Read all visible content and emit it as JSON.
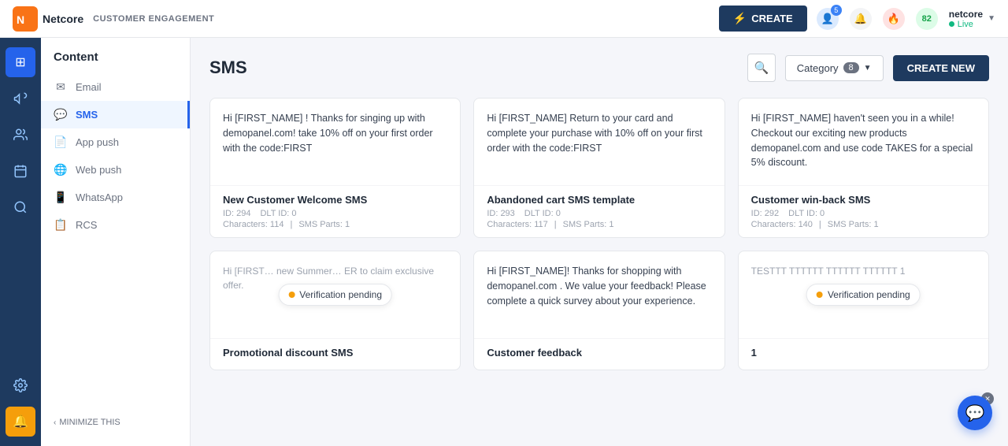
{
  "topnav": {
    "logo_text": "Netcore",
    "section_label": "CUSTOMER ENGAGEMENT",
    "create_button": "CREATE",
    "user_name": "netcore",
    "status": "Live",
    "notification_count": "5",
    "points": "82"
  },
  "sidebar": {
    "title": "Content",
    "items": [
      {
        "id": "email",
        "label": "Email",
        "icon": "✉"
      },
      {
        "id": "sms",
        "label": "SMS",
        "icon": "💬"
      },
      {
        "id": "app-push",
        "label": "App push",
        "icon": "📄"
      },
      {
        "id": "web-push",
        "label": "Web push",
        "icon": "🌐"
      },
      {
        "id": "whatsapp",
        "label": "WhatsApp",
        "icon": "📱"
      },
      {
        "id": "rcs",
        "label": "RCS",
        "icon": "📋"
      }
    ],
    "minimize_label": "MINIMIZE THIS"
  },
  "page": {
    "title": "SMS",
    "category_label": "Category",
    "category_count": "8",
    "create_new_label": "CREATE NEW"
  },
  "cards": [
    {
      "id": 1,
      "preview": "Hi [FIRST_NAME] ! Thanks for singing up with demopanel.com! take 10% off on your first order with the code:FIRST",
      "name": "New Customer Welcome SMS",
      "id_label": "ID: 294",
      "dlt_label": "DLT ID: 0",
      "chars": "Characters: 114",
      "sms_parts": "SMS Parts: 1",
      "verification": false
    },
    {
      "id": 2,
      "preview": "Hi [FIRST_NAME] Return to your card and complete your purchase with 10% off on your first order with the code:FIRST",
      "name": "Abandoned cart SMS template",
      "id_label": "ID: 293",
      "dlt_label": "DLT ID: 0",
      "chars": "Characters: 117",
      "sms_parts": "SMS Parts: 1",
      "verification": false
    },
    {
      "id": 3,
      "preview": "Hi [FIRST_NAME] haven't seen you in a while! Checkout our exciting new products demopanel.com and use code TAKES for a special 5% discount.",
      "name": "Customer win-back SMS",
      "id_label": "ID: 292",
      "dlt_label": "DLT ID: 0",
      "chars": "Characters: 140",
      "sms_parts": "SMS Parts: 1",
      "verification": false
    },
    {
      "id": 4,
      "preview": "Hi [FIRST... new Summer... ER to claim exclusive offer.",
      "name": "Promotional discount SMS",
      "id_label": "",
      "dlt_label": "",
      "chars": "",
      "sms_parts": "",
      "verification": true,
      "verification_label": "Verification pending"
    },
    {
      "id": 5,
      "preview": "Hi [FIRST_NAME]! Thanks for shopping with demopanel.com . We value your feedback! Please complete a quick survey about your experience.",
      "name": "Customer feedback",
      "id_label": "",
      "dlt_label": "",
      "chars": "",
      "sms_parts": "",
      "verification": false
    },
    {
      "id": 6,
      "preview": "TESTTT TTTTTT TTTTTT TTTTTT 1",
      "name": "1",
      "id_label": "",
      "dlt_label": "",
      "chars": "",
      "sms_parts": "",
      "verification": true,
      "verification_label": "Verification pending"
    }
  ],
  "icon_sidebar": {
    "icons": [
      {
        "id": "grid",
        "symbol": "⊞",
        "active": true
      },
      {
        "id": "megaphone",
        "symbol": "📢",
        "active": false
      },
      {
        "id": "users",
        "symbol": "👤",
        "active": false
      },
      {
        "id": "calendar",
        "symbol": "📅",
        "active": false
      },
      {
        "id": "search2",
        "symbol": "🔍",
        "active": false
      }
    ],
    "bottom_icons": [
      {
        "id": "settings",
        "symbol": "⚙"
      },
      {
        "id": "notification2",
        "symbol": "🔔"
      }
    ]
  }
}
